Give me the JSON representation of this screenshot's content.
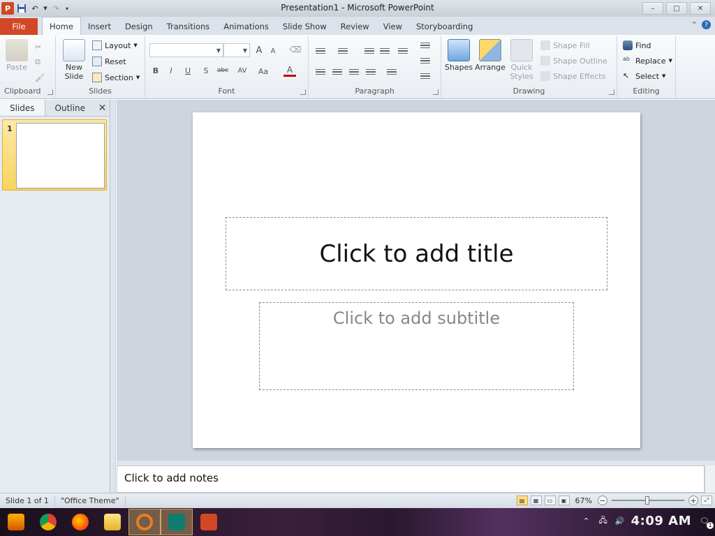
{
  "window": {
    "title": "Presentation1  -  Microsoft PowerPoint",
    "controls": {
      "minimize": "–",
      "maximize": "□",
      "close": "✕"
    }
  },
  "ribbon_tabs": [
    "File",
    "Home",
    "Insert",
    "Design",
    "Transitions",
    "Animations",
    "Slide Show",
    "Review",
    "View",
    "Storyboarding"
  ],
  "active_tab": "Home",
  "ribbon": {
    "clipboard": {
      "label": "Clipboard",
      "paste": "Paste"
    },
    "slides": {
      "label": "Slides",
      "new_slide_1": "New",
      "new_slide_2": "Slide",
      "layout": "Layout",
      "reset": "Reset",
      "section": "Section"
    },
    "font": {
      "label": "Font",
      "bold": "B",
      "italic": "I",
      "underline": "U",
      "shadow": "S",
      "strike": "abc",
      "spacing": "AV",
      "case": "Aa",
      "color": "A",
      "grow": "A",
      "shrink": "A"
    },
    "paragraph": {
      "label": "Paragraph"
    },
    "drawing": {
      "label": "Drawing",
      "shapes": "Shapes",
      "arrange": "Arrange",
      "quick_styles_1": "Quick",
      "quick_styles_2": "Styles",
      "shape_fill": "Shape Fill",
      "shape_outline": "Shape Outline",
      "shape_effects": "Shape Effects"
    },
    "editing": {
      "label": "Editing",
      "find": "Find",
      "replace": "Replace",
      "select": "Select"
    }
  },
  "left_pane": {
    "tabs": [
      "Slides",
      "Outline"
    ],
    "close": "✕",
    "slide_number": "1"
  },
  "slide": {
    "title_placeholder": "Click to add title",
    "subtitle_placeholder": "Click to add subtitle"
  },
  "notes": {
    "placeholder": "Click to add notes"
  },
  "status_bar": {
    "slide_info": "Slide 1 of 1",
    "theme": "\"Office Theme\"",
    "zoom": "67%",
    "zoom_level_percent": 67
  },
  "taskbar": {
    "clock": "4:09 AM",
    "notification_count": "1"
  },
  "colors": {
    "file_tab": "#d24726",
    "ribbon_bg": "#e8edf2",
    "slide_area_bg": "#ced5df",
    "thumbnail_selected": "#f7d35f"
  }
}
